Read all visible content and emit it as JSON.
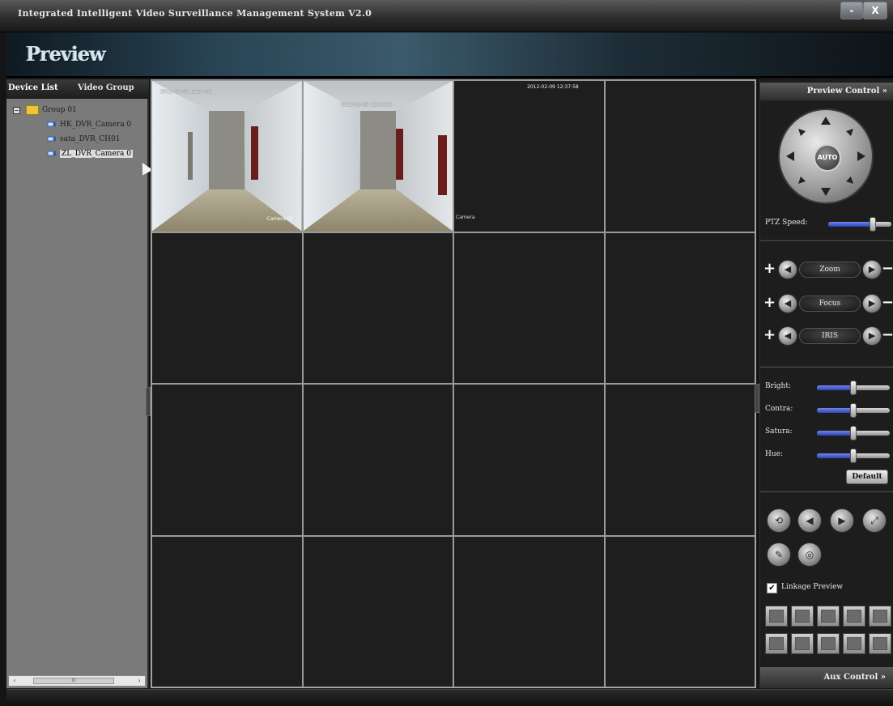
{
  "window": {
    "title": "Integrated Intelligent Video Surveillance Management System V2.0",
    "minimize": "-",
    "close": "X"
  },
  "header": {
    "title": "Preview"
  },
  "left_panel": {
    "tabs": [
      "Device List",
      "Video Group"
    ],
    "tree": {
      "group": {
        "expander": "−",
        "label": "Group 01"
      },
      "devices": [
        {
          "label": "HK_DVR_Camera 0",
          "selected": false
        },
        {
          "label": "sata_DVR_CH01",
          "selected": false
        },
        {
          "label": "ZL_DVR_Camera 0",
          "selected": true
        }
      ]
    },
    "scrollbar": {
      "left": "‹",
      "right": "›",
      "thumb": "III"
    }
  },
  "video_grid": {
    "cells": [
      {
        "timestamp": "2012-02-09 12:37:05",
        "camera": "Camera 01",
        "active": true,
        "has_video": true
      },
      {
        "timestamp": "2012-02-09 12:44:25",
        "camera": "",
        "active": false,
        "has_video": true
      },
      {
        "timestamp": "2012-02-09 12:37:58",
        "camera": "Camera",
        "active": false,
        "has_video": false
      }
    ]
  },
  "right_panel": {
    "header": "Preview Control »",
    "ptz": {
      "auto": "AUTO",
      "speed_label": "PTZ Speed:",
      "speed_value": 0.7
    },
    "lens": [
      {
        "label": "Zoom",
        "plus": "+",
        "minus": "−",
        "left": "◀",
        "right": "▶"
      },
      {
        "label": "Focus",
        "plus": "+",
        "minus": "−",
        "left": "◀",
        "right": "▶"
      },
      {
        "label": "IRIS",
        "plus": "+",
        "minus": "−",
        "left": "◀",
        "right": "▶"
      }
    ],
    "image": [
      {
        "label": "Bright:",
        "value": 0.5
      },
      {
        "label": "Contra:",
        "value": 0.5
      },
      {
        "label": "Satura:",
        "value": 0.5
      },
      {
        "label": "Hue:",
        "value": 0.5
      }
    ],
    "default_label": "Default",
    "tool_buttons": [
      "⟲",
      "◀",
      "▶",
      "⤢",
      "✎",
      "◎"
    ],
    "linkage": {
      "checked": true,
      "check_mark": "✔",
      "label": "Linkage Preview"
    },
    "aux_label": "Aux Control »"
  },
  "colors": {
    "active_cell_border": "#b51c1c",
    "slider_fill": "#3a52c8"
  }
}
